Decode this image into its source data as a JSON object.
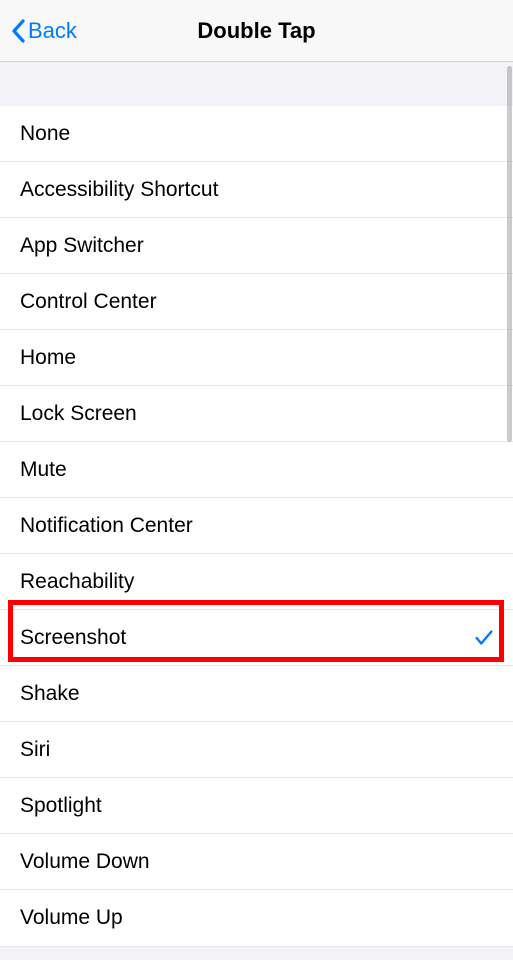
{
  "nav": {
    "back_label": "Back",
    "title": "Double Tap"
  },
  "selected_index": 9,
  "options": [
    {
      "label": "None"
    },
    {
      "label": "Accessibility Shortcut"
    },
    {
      "label": "App Switcher"
    },
    {
      "label": "Control Center"
    },
    {
      "label": "Home"
    },
    {
      "label": "Lock Screen"
    },
    {
      "label": "Mute"
    },
    {
      "label": "Notification Center"
    },
    {
      "label": "Reachability"
    },
    {
      "label": "Screenshot"
    },
    {
      "label": "Shake"
    },
    {
      "label": "Siri"
    },
    {
      "label": "Spotlight"
    },
    {
      "label": "Volume Down"
    },
    {
      "label": "Volume Up"
    }
  ]
}
